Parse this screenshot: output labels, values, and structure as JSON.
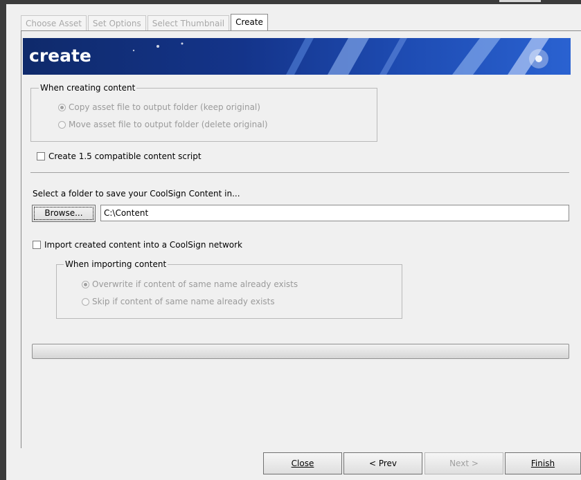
{
  "tabs": [
    "Choose Asset",
    "Set Options",
    "Select Thumbnail",
    "Create"
  ],
  "active_tab": "Create",
  "banner": {
    "title": "create"
  },
  "content_group": {
    "label": "When creating content",
    "options": [
      {
        "label": "Copy asset file to output folder (keep original)",
        "selected": true
      },
      {
        "label": "Move asset file to output folder (delete original)",
        "selected": false
      }
    ]
  },
  "compat_checkbox": {
    "label": "Create 1.5 compatible content script",
    "checked": false
  },
  "folder": {
    "prompt": "Select a folder to save your CoolSign Content in...",
    "browse_label": "Browse...",
    "path_value": "C:\\Content"
  },
  "import_checkbox": {
    "label": "Import created content into a CoolSign network",
    "checked": false
  },
  "import_group": {
    "label": "When importing content",
    "options": [
      {
        "label": "Overwrite if content of same name already exists",
        "selected": true
      },
      {
        "label": "Skip if content of same name already exists",
        "selected": false
      }
    ]
  },
  "progress": {
    "value": 0
  },
  "footer": {
    "close": "Close",
    "prev": "< Prev",
    "next": "Next >",
    "finish": "Finish"
  }
}
